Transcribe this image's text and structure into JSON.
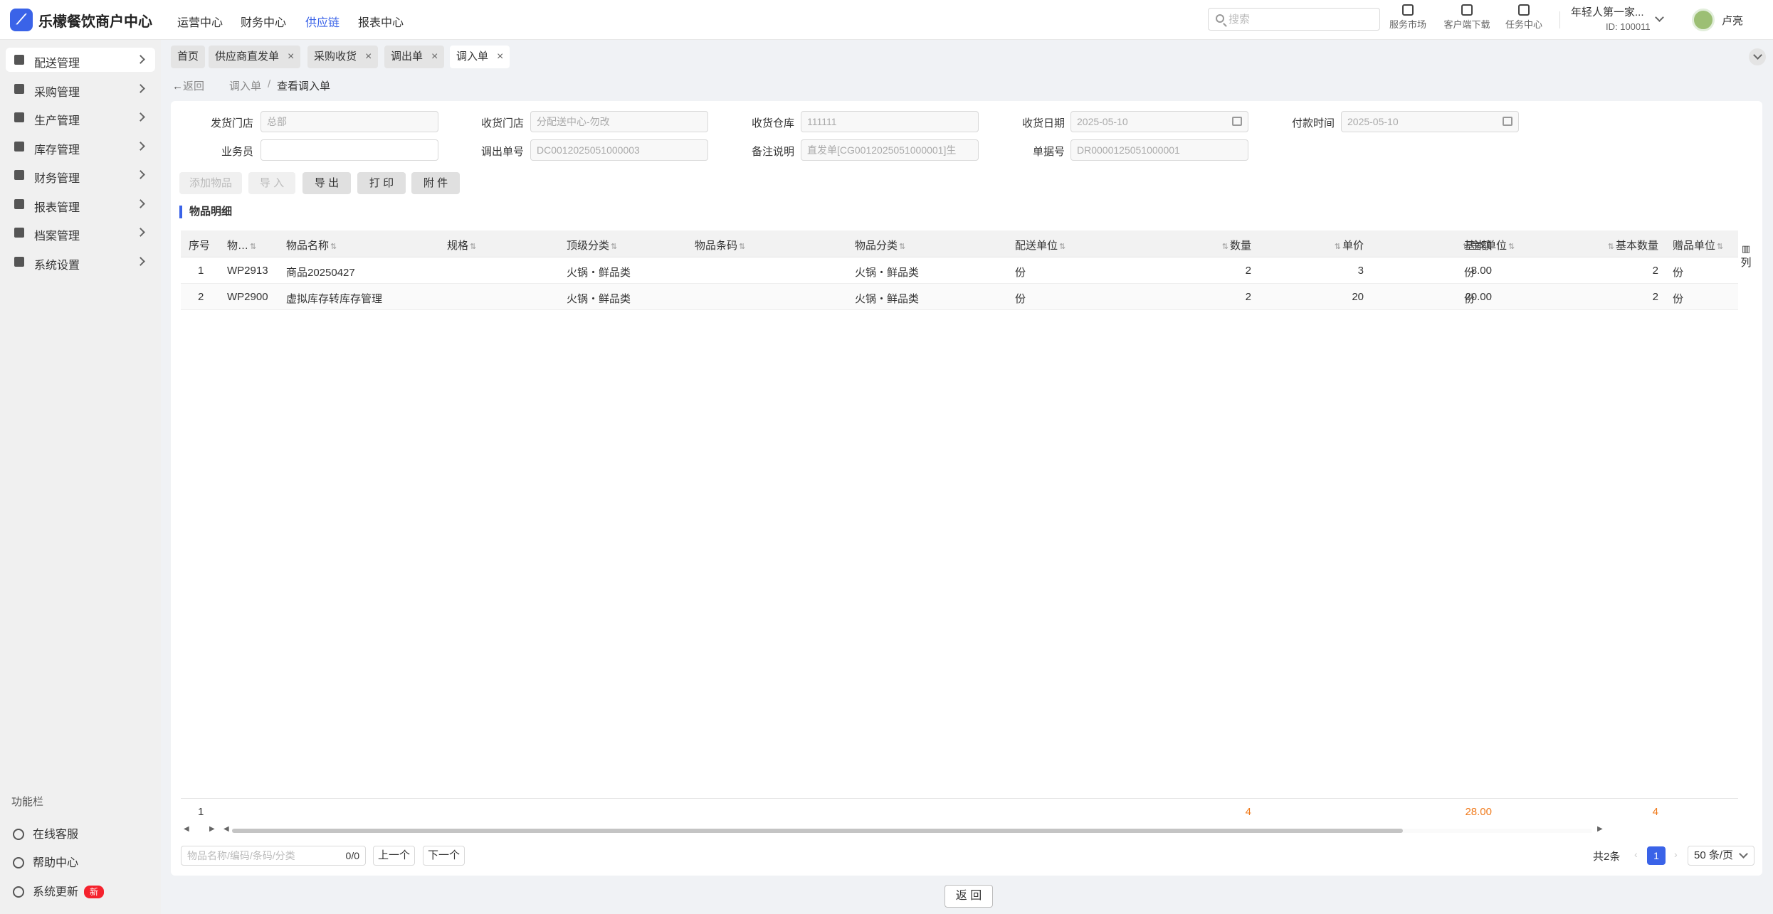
{
  "app": {
    "logo_glyph": "⟋",
    "title": "乐檬餐饮商户中心"
  },
  "topnav": [
    "运营中心",
    "财务中心",
    "供应链",
    "报表中心"
  ],
  "search": {
    "placeholder": "搜索",
    "value": ""
  },
  "tools": {
    "market": "服务市场",
    "download": "客户端下载",
    "tasks": "任务中心"
  },
  "org": {
    "name": "年轻人第一家...",
    "id": "ID: 100011"
  },
  "user": {
    "name": "卢亮"
  },
  "sidebar": {
    "items": [
      "配送管理",
      "采购管理",
      "生产管理",
      "库存管理",
      "财务管理",
      "报表管理",
      "档案管理",
      "系统设置"
    ],
    "func_title": "功能栏",
    "func": [
      "在线客服",
      "帮助中心",
      "系统更新"
    ],
    "new_badge": "新"
  },
  "tabs": [
    "首页",
    "供应商直发单",
    "采购收货",
    "调出单",
    "调入单"
  ],
  "breadcrumb": {
    "back": "返回",
    "parent": "调入单",
    "sep": "/",
    "current": "查看调入单"
  },
  "form": {
    "send_store": {
      "label": "发货门店",
      "value": "总部"
    },
    "recv_store": {
      "label": "收货门店",
      "value": "分配送中心-勿改"
    },
    "recv_wh": {
      "label": "收货仓库",
      "value": "111111"
    },
    "recv_date": {
      "label": "收货日期",
      "value": "2025-05-10"
    },
    "pay_time": {
      "label": "付款时间",
      "value": "2025-05-10"
    },
    "salesman": {
      "label": "业务员",
      "value": ""
    },
    "out_no": {
      "label": "调出单号",
      "value": "DC0012025051000003"
    },
    "remark": {
      "label": "备注说明",
      "value": "直发单[CG0012025051000001]生"
    },
    "doc_no": {
      "label": "单据号",
      "value": "DR0000125051000001"
    }
  },
  "actions": {
    "add": "添加物品",
    "import": "导 入",
    "export": "导 出",
    "print": "打 印",
    "attach": "附 件"
  },
  "section_title": "物品明细",
  "table": {
    "headers": [
      "序号",
      "物…",
      "物品名称",
      "规格",
      "顶级分类",
      "物品条码",
      "物品分类",
      "配送单位",
      "数量",
      "单价",
      "金额",
      "基本单位",
      "基本数量",
      "赠品单位"
    ],
    "rows": [
      [
        "1",
        "WP2913",
        "商品20250427",
        "",
        "火锅・鲜品类",
        "",
        "火锅・鲜品类",
        "份",
        "2",
        "3",
        "8.00",
        "份",
        "2",
        "份"
      ],
      [
        "2",
        "WP2900",
        "虚拟库存转库存管理",
        "",
        "火锅・鲜品类",
        "",
        "火锅・鲜品类",
        "份",
        "2",
        "20",
        "20.00",
        "份",
        "2",
        "份"
      ]
    ],
    "col_selector": "列",
    "totals": {
      "count": "1",
      "qty": "4",
      "amount": "28.00",
      "base_qty": "4"
    }
  },
  "footer": {
    "find_placeholder": "物品名称/编码/条码/分类",
    "find_count": "0/0",
    "prev": "上一个",
    "next": "下一个",
    "total": "共2条",
    "page": "1",
    "page_size": "50 条/页",
    "back": "返 回"
  },
  "colors": {
    "accent": "#3a63e8",
    "total": "#f07b1d",
    "badge": "#f5222d"
  }
}
